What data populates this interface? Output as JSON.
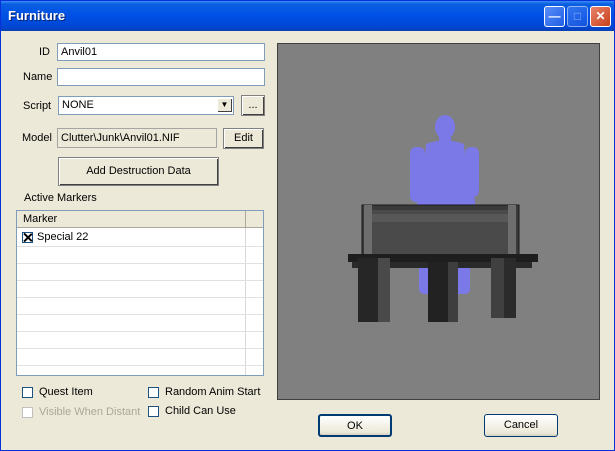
{
  "window": {
    "title": "Furniture"
  },
  "titlebar_buttons": [
    "minimize-icon",
    "maximize-icon",
    "close-icon"
  ],
  "form": {
    "id_label": "ID",
    "id_value": "Anvil01",
    "name_label": "Name",
    "name_value": "",
    "script_label": "Script",
    "script_value": "NONE",
    "script_browse_label": "...",
    "model_label": "Model",
    "model_value": "Clutter\\Junk\\Anvil01.NIF",
    "edit_label": "Edit",
    "add_destruction_label": "Add Destruction Data",
    "active_markers_label": "Active Markers"
  },
  "markers_table": {
    "columns": [
      "Marker"
    ],
    "rows": [
      {
        "label": "Special 22",
        "checked": true
      }
    ]
  },
  "options": {
    "quest_item": {
      "label": "Quest Item",
      "checked": false
    },
    "visible_when_distant": {
      "label": "Visible When Distant",
      "checked": false,
      "disabled": true
    },
    "random_anim_start": {
      "label": "Random Anim Start",
      "checked": false
    },
    "child_can_use": {
      "label": "Child Can Use",
      "checked": false
    }
  },
  "footer": {
    "ok_label": "OK",
    "cancel_label": "Cancel"
  },
  "colors": {
    "titlebar": "#0050e6",
    "viewport_bg": "#808080",
    "ghost_figure": "#7b78e8",
    "anvil": "#2e2e2e"
  }
}
